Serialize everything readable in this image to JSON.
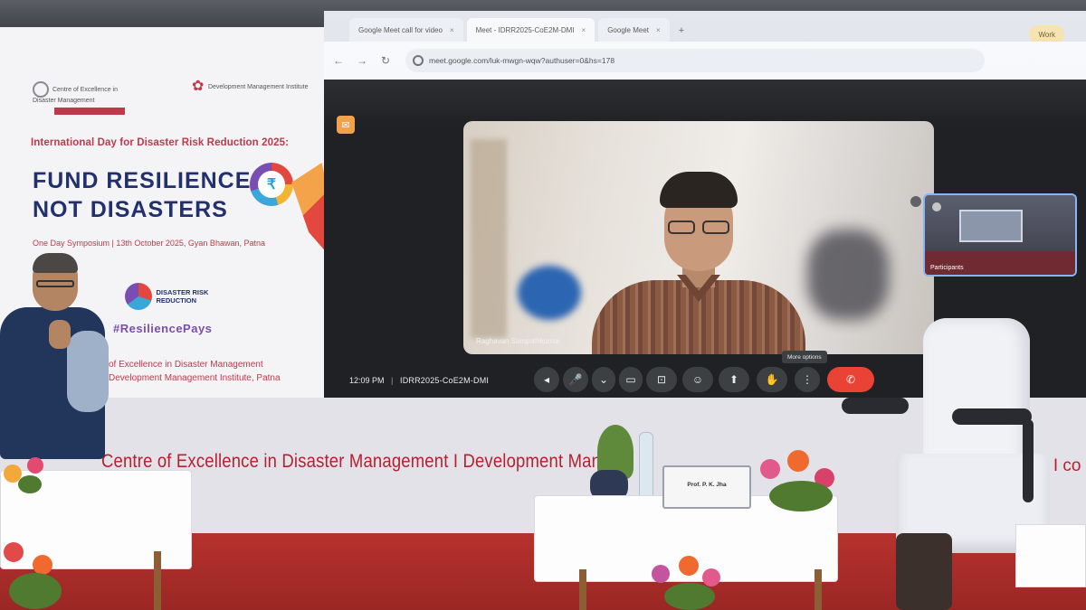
{
  "standee": {
    "logo_left_text": "Centre of Excellence in Disaster Management",
    "logo_right_text": "Development Management Institute",
    "subtitle": "International Day for Disaster Risk Reduction 2025:",
    "headline_line1": "FUND RESILIENCE,",
    "headline_line2": "NOT DISASTERS",
    "event_line": "One Day Symposium | 13th October 2025, Gyan Bhawan, Patna",
    "idrr_logo_text": "DISASTER RISK REDUCTION",
    "hashtag": "#ResiliencePays",
    "footer_line1": "of Excellence in Disaster Management",
    "footer_line2": "Development Management Institute, Patna"
  },
  "browser": {
    "tabs": [
      {
        "label": "Google Meet call for video"
      },
      {
        "label": "Meet - IDRR2025-CoE2M-DMI",
        "active": true
      },
      {
        "label": "Google Meet"
      }
    ],
    "new_tab_icon": "plus-icon",
    "profile_pill": "Work",
    "address": "meet.google.com/luk-mwgn-wqw?authuser=0&hs=178",
    "nav_icons": [
      "back-icon",
      "forward-icon",
      "reload-icon"
    ]
  },
  "meet": {
    "speaker_name": "Raghavan Sampathkumar",
    "self_label": "Participants",
    "time": "12:09 PM",
    "meeting_code": "IDRR2025-CoE2M-DMI",
    "tooltip": "More options",
    "controls": [
      {
        "name": "audio-settings-icon",
        "glyph": "◂"
      },
      {
        "name": "mic-icon",
        "glyph": "🎤"
      },
      {
        "name": "camera-dropdown-icon",
        "glyph": "⌄"
      },
      {
        "name": "camera-icon",
        "glyph": "▭"
      },
      {
        "name": "captions-icon",
        "glyph": "⊡"
      },
      {
        "name": "emoji-icon",
        "glyph": "☺"
      },
      {
        "name": "present-icon",
        "glyph": "⬆"
      },
      {
        "name": "raise-hand-icon",
        "glyph": "✋"
      },
      {
        "name": "more-options-icon",
        "glyph": "⋮"
      },
      {
        "name": "end-call-icon",
        "glyph": "✆"
      }
    ],
    "accent": "#8ab4f8",
    "end_call_color": "#ea4335"
  },
  "stage": {
    "banner": "Centre of Excellence in Disaster Management I Development Man",
    "banner_right": "n I co",
    "plaque_name": "Prof. P. K. Jha"
  }
}
